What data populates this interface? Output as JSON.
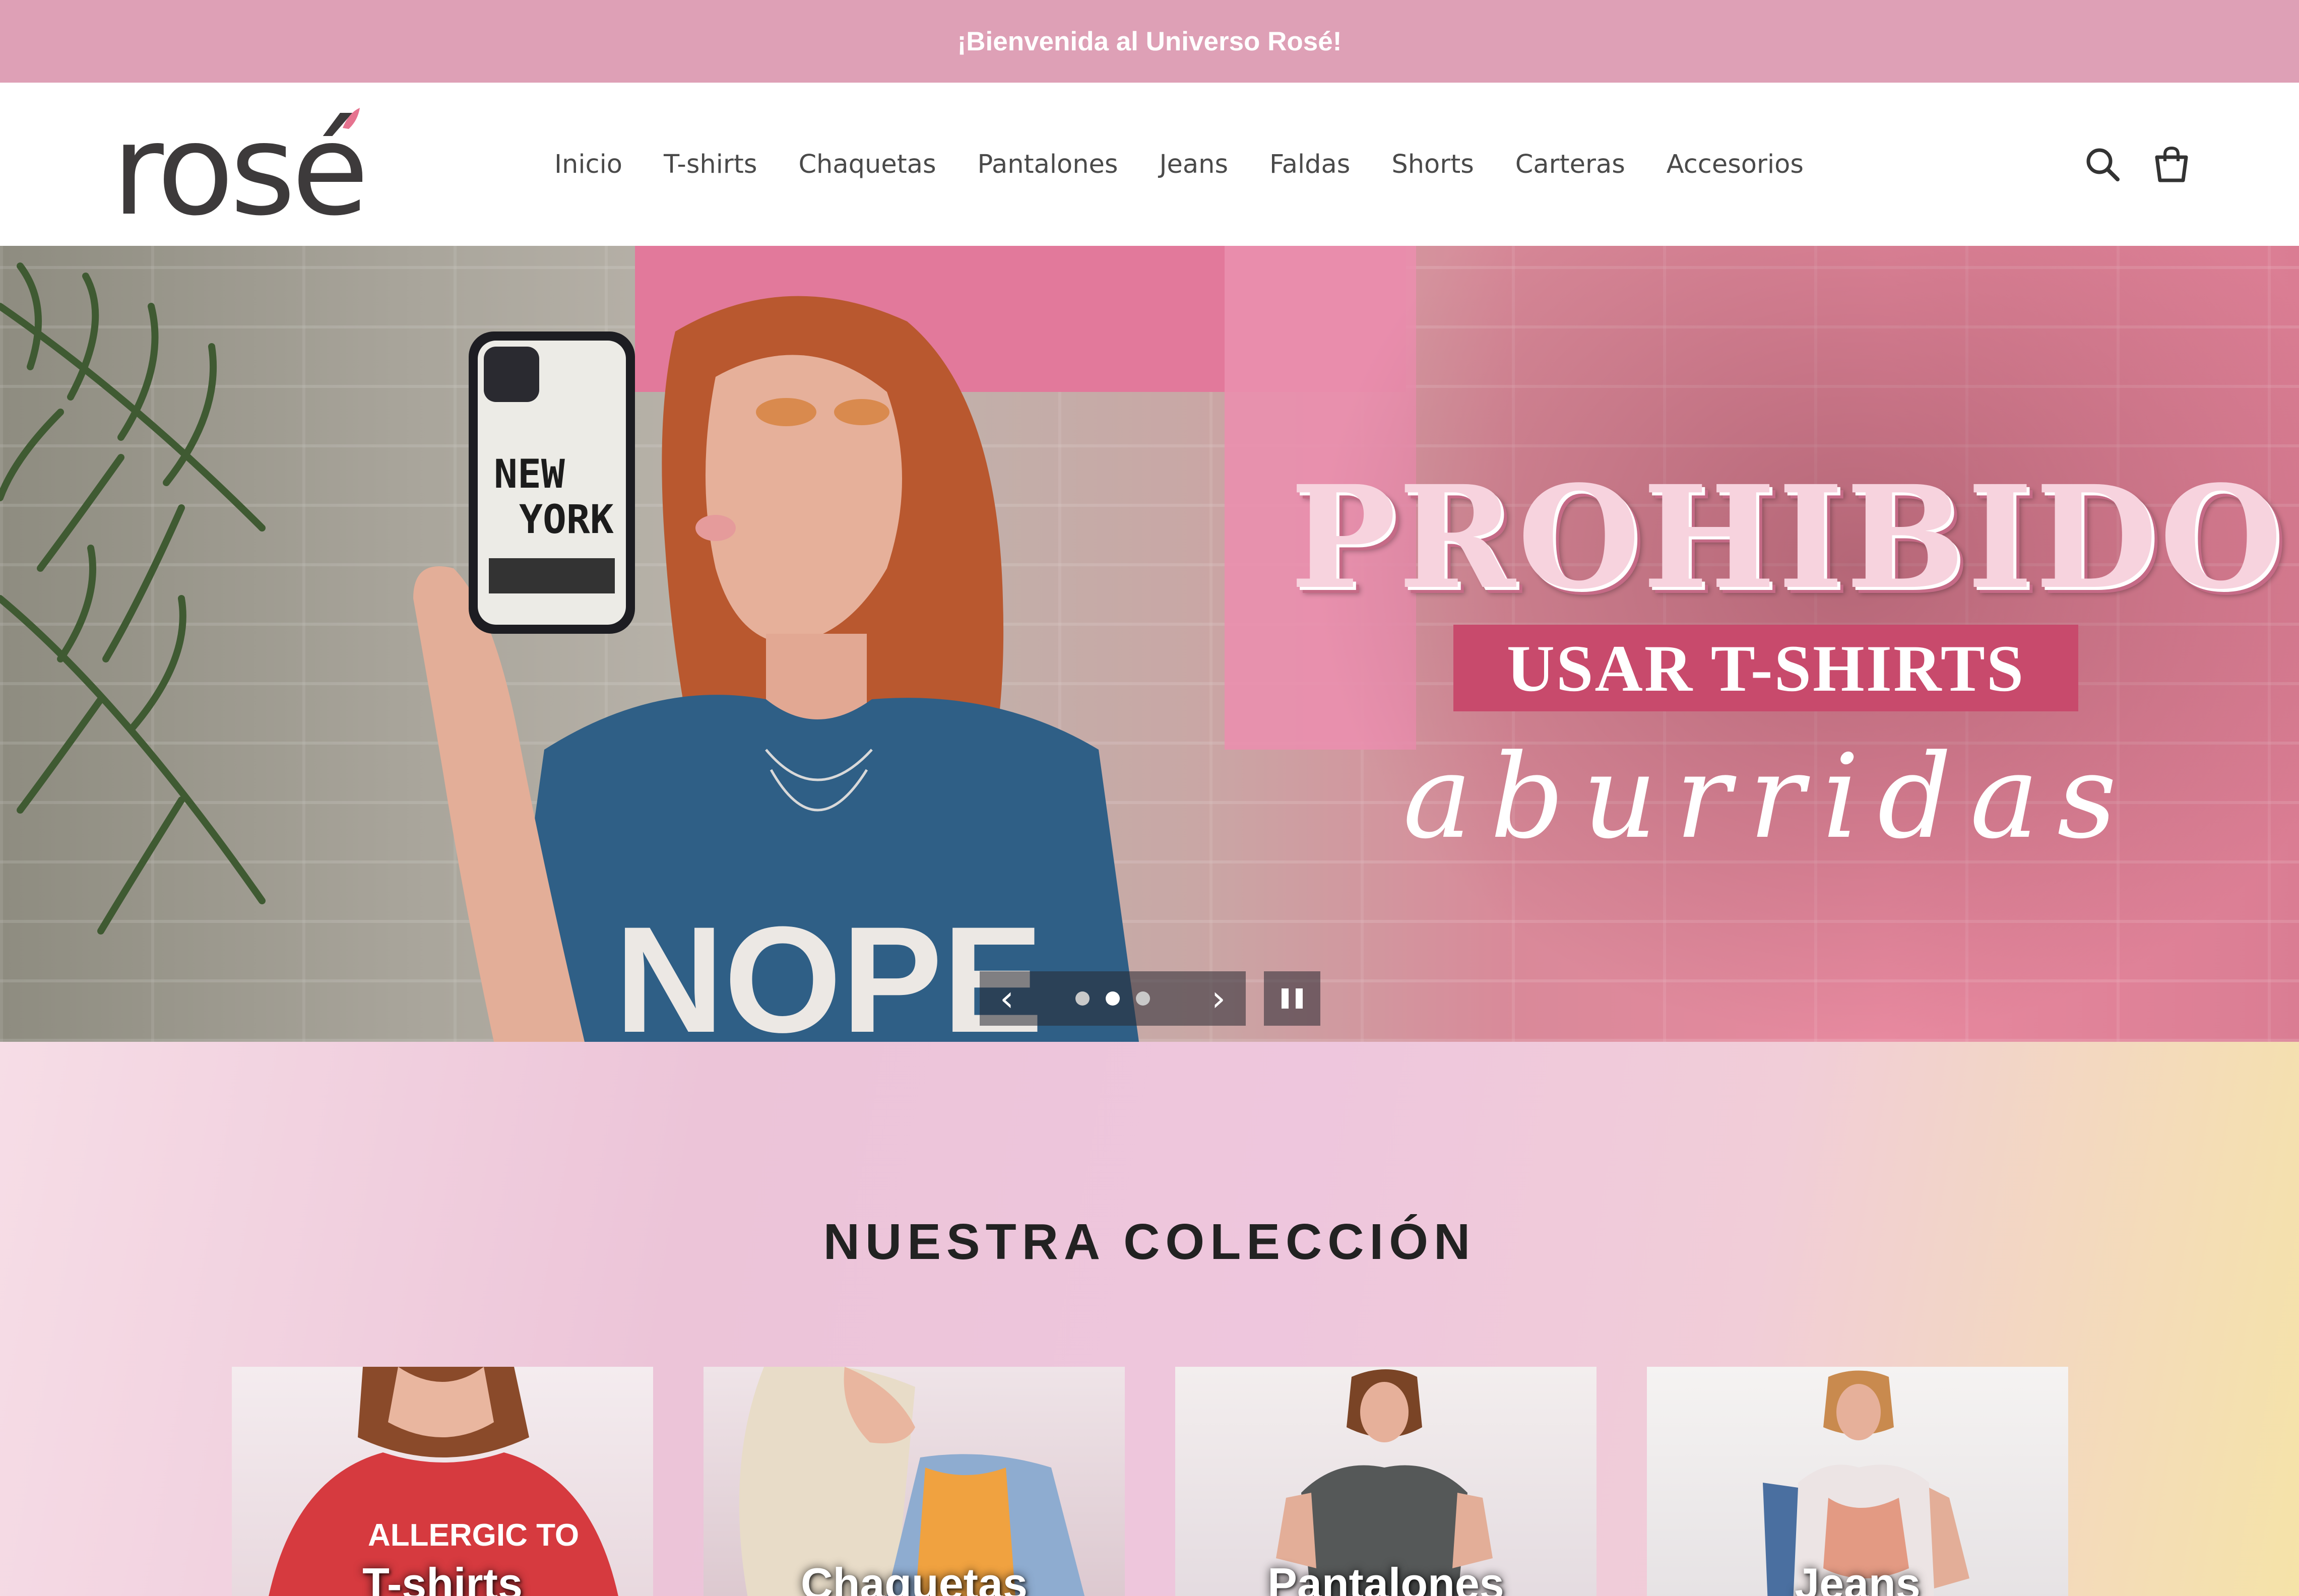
{
  "announcement": "¡Bienvenida al Universo Rosé!",
  "brand": {
    "logo_text": "rosé",
    "accent": "#e6738f"
  },
  "nav": [
    "Inicio",
    "T-shirts",
    "Chaquetas",
    "Pantalones",
    "Jeans",
    "Faldas",
    "Shorts",
    "Carteras",
    "Accesorios"
  ],
  "header_icons": [
    "search-icon",
    "cart-icon"
  ],
  "hero": {
    "line1": "PROHIBIDO",
    "line2": "USAR T-SHIRTS",
    "line3": "aburridas",
    "phone_text_1": "NEW",
    "phone_text_2": "YORK",
    "shirt_text": "NOPE",
    "slides": 3,
    "active_slide": 2,
    "prev_label": "‹",
    "next_label": "›"
  },
  "collection": {
    "title": "NUESTRA COLECCIÓN",
    "items": [
      {
        "label": "T-shirts",
        "shirt_text": "ALLERGIC TO"
      },
      {
        "label": "Chaquetas"
      },
      {
        "label": "Pantalones"
      },
      {
        "label": "Jeans"
      }
    ]
  },
  "colors": {
    "announcement_bg": "#dea0b6",
    "promo_box": "#c84a6c",
    "text_dark": "#222222"
  }
}
